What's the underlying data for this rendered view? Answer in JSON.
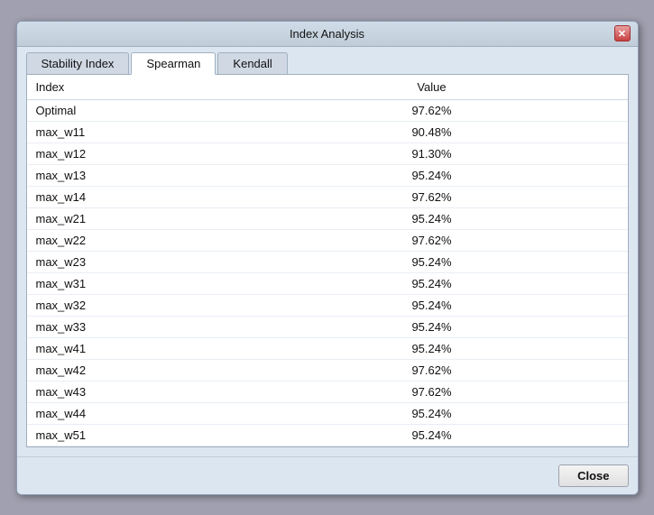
{
  "dialog": {
    "title": "Index Analysis",
    "close_x_label": "✕"
  },
  "tabs": [
    {
      "id": "stability",
      "label": "Stability Index",
      "active": false
    },
    {
      "id": "spearman",
      "label": "Spearman",
      "active": true
    },
    {
      "id": "kendall",
      "label": "Kendall",
      "active": false
    }
  ],
  "table": {
    "headers": [
      "Index",
      "Value"
    ],
    "rows": [
      {
        "index": "Optimal",
        "value": "97.62%"
      },
      {
        "index": "max_w11",
        "value": "90.48%"
      },
      {
        "index": "max_w12",
        "value": "91.30%"
      },
      {
        "index": "max_w13",
        "value": "95.24%"
      },
      {
        "index": "max_w14",
        "value": "97.62%"
      },
      {
        "index": "max_w21",
        "value": "95.24%"
      },
      {
        "index": "max_w22",
        "value": "97.62%"
      },
      {
        "index": "max_w23",
        "value": "95.24%"
      },
      {
        "index": "max_w31",
        "value": "95.24%"
      },
      {
        "index": "max_w32",
        "value": "95.24%"
      },
      {
        "index": "max_w33",
        "value": "95.24%"
      },
      {
        "index": "max_w41",
        "value": "95.24%"
      },
      {
        "index": "max_w42",
        "value": "97.62%"
      },
      {
        "index": "max_w43",
        "value": "97.62%"
      },
      {
        "index": "max_w44",
        "value": "95.24%"
      },
      {
        "index": "max_w51",
        "value": "95.24%"
      }
    ]
  },
  "footer": {
    "close_label": "Close"
  }
}
